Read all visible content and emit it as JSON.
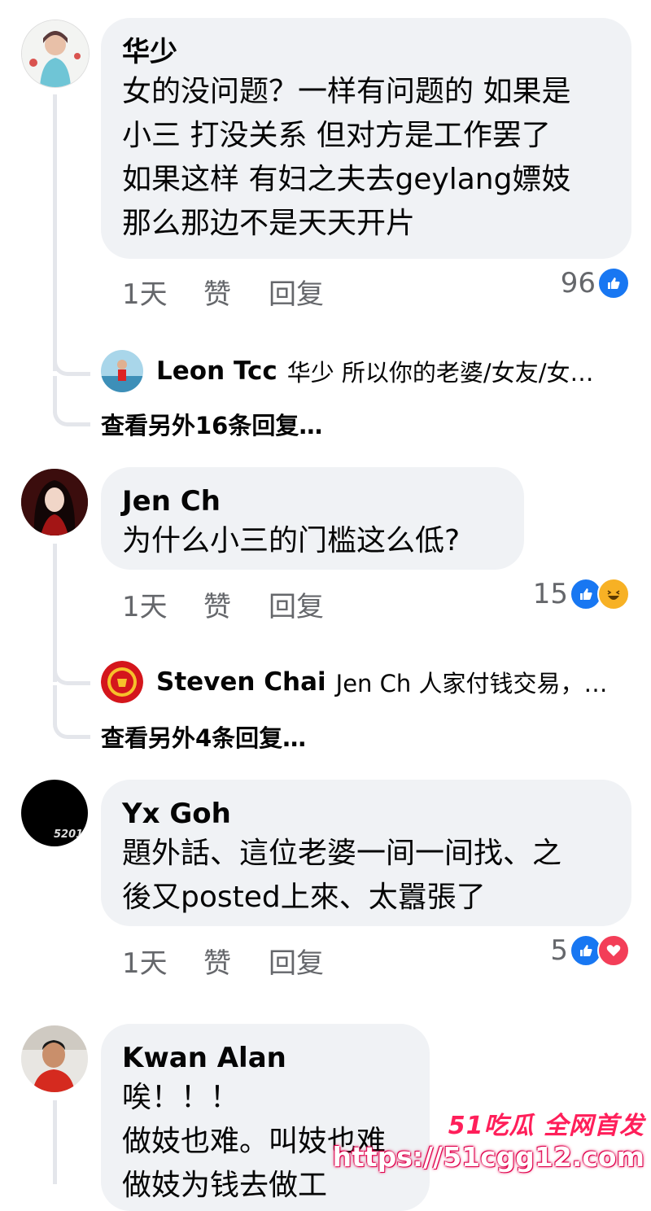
{
  "comments": [
    {
      "author": "华少",
      "text": "女的没问题？一样有问题的 如果是\n小三 打没关系 但对方是工作罢了\n如果这样 有妇之夫去geylang嫖妓\n那么那边不是天天开片",
      "time": "1天",
      "like": "赞",
      "reply": "回复",
      "reaction_count": "96",
      "reactions": [
        "like-icon"
      ],
      "preview_reply": {
        "author": "Leon Tcc",
        "text": "华少 所以你的老婆/女友/女…"
      },
      "more_replies": "查看另外16条回复…"
    },
    {
      "author": "Jen Ch",
      "text": "为什么小三的门槛这么低?",
      "time": "1天",
      "like": "赞",
      "reply": "回复",
      "reaction_count": "15",
      "reactions": [
        "like-icon",
        "haha-icon"
      ],
      "preview_reply": {
        "author": "Steven Chai",
        "text": "Jen Ch 人家付钱交易，…"
      },
      "more_replies": "查看另外4条回复…"
    },
    {
      "author": "Yx Goh",
      "text": "題外話、這位老婆一间一间找、之\n後又posted上來、太囂張了",
      "avatar_text": "5201",
      "time": "1天",
      "like": "赞",
      "reply": "回复",
      "reaction_count": "5",
      "reactions": [
        "like-icon",
        "love-icon"
      ]
    },
    {
      "author": "Kwan Alan",
      "text": "唉！！！\n做妓也难。叫妓也难\n做妓为钱去做工"
    }
  ],
  "watermark": {
    "line1": "51吃瓜 全网首发",
    "line2": "https://51cgg12.com"
  },
  "colors": {
    "bubble": "#f0f2f5",
    "like_blue": "#1877f2",
    "secondary_text": "#65676b",
    "thread_line": "#e4e6eb",
    "watermark_pink": "#ff1f5a"
  }
}
